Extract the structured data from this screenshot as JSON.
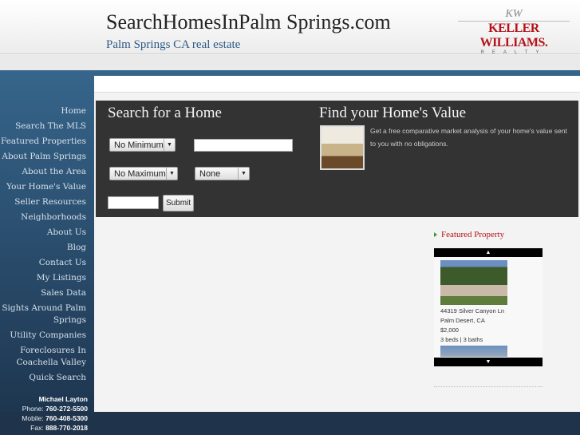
{
  "header": {
    "title": "SearchHomesInPalm Springs.com",
    "tagline": "Palm Springs CA real estate",
    "logo": {
      "brand": "KELLER WILLIAMS.",
      "sub": "REALTY",
      "monogram": "KW"
    }
  },
  "nav": [
    "Home",
    "Search The MLS",
    "Featured Properties",
    "About Palm Springs",
    "About the Area",
    "Your Home's Value",
    "Seller Resources",
    "Neighborhoods",
    "About Us",
    "Blog",
    "Contact Us",
    "My Listings",
    "Sales Data",
    "Sights Around Palm Springs",
    "Utility Companies",
    "Foreclosures In Coachella Valley",
    "Quick Search"
  ],
  "contact": {
    "name": "Michael Layton",
    "phone_label": "Phone:",
    "phone": "760-272-5500",
    "mobile_label": "Mobile:",
    "mobile": "760-408-5300",
    "fax_label": "Fax:",
    "fax": "888-770-2018"
  },
  "search": {
    "title": "Search for a Home",
    "min_price": "No Minimum",
    "max_price": "No Maximum",
    "beds": "None",
    "location_value": "",
    "zip_value": "",
    "submit": "Submit"
  },
  "value": {
    "title": "Find your Home's Value",
    "text": "Get a free comparative market analysis of your home's value sent to you with no obligations."
  },
  "featured": {
    "title": "Featured Property",
    "address": "44319 Silver Canyon Ln",
    "city": "Palm Desert, CA",
    "price": "$2,000",
    "details": "3 beds | 3 baths"
  },
  "colors": {
    "nav_blue": "#35648a",
    "accent_red": "#b5121b",
    "panel": "#333333"
  }
}
